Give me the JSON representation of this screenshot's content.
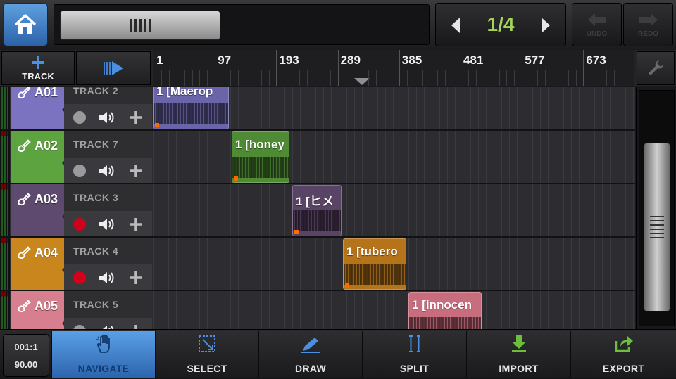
{
  "header": {
    "page_indicator": "1/4",
    "undo_label": "UNDO",
    "redo_label": "REDO"
  },
  "ruler": {
    "add_track_label": "TRACK",
    "marks": [
      "1",
      "97",
      "193",
      "289",
      "385",
      "481",
      "577",
      "673"
    ]
  },
  "tracks": [
    {
      "id": "A01",
      "name": "TRACK 2",
      "color": "#7b73c0",
      "armed": false,
      "clip": {
        "title": "1 [Maerop",
        "color": "#6a64a8"
      }
    },
    {
      "id": "A02",
      "name": "TRACK 7",
      "color": "#5da33f",
      "armed": false,
      "clip": {
        "title": "1 [honey",
        "color": "#4f8a35"
      }
    },
    {
      "id": "A03",
      "name": "TRACK 3",
      "color": "#5e4a6e",
      "armed": true,
      "clip": {
        "title": "1 [ヒメ",
        "color": "#5a4466"
      }
    },
    {
      "id": "A04",
      "name": "TRACK 4",
      "color": "#c8861c",
      "armed": true,
      "clip": {
        "title": "1 [tubero",
        "color": "#b5741a"
      }
    },
    {
      "id": "A05",
      "name": "TRACK 5",
      "color": "#d77f8f",
      "armed": false,
      "clip": {
        "title": "1 [innocen",
        "color": "#c86d7d"
      }
    }
  ],
  "transport": {
    "position": "001:1",
    "tempo": "90.00"
  },
  "tools": [
    {
      "label": "NAVIGATE",
      "icon": "hand-icon",
      "active": true
    },
    {
      "label": "SELECT",
      "icon": "select-icon",
      "active": false
    },
    {
      "label": "DRAW",
      "icon": "pencil-icon",
      "active": false
    },
    {
      "label": "SPLIT",
      "icon": "split-icon",
      "active": false
    },
    {
      "label": "IMPORT",
      "icon": "import-icon",
      "active": false
    },
    {
      "label": "EXPORT",
      "icon": "export-icon",
      "active": false
    }
  ],
  "colors": {
    "accent": "#3a7bd5",
    "page_indicator": "#a6d45a",
    "record_armed": "#d0021b",
    "record_idle": "#9a9a9a"
  }
}
